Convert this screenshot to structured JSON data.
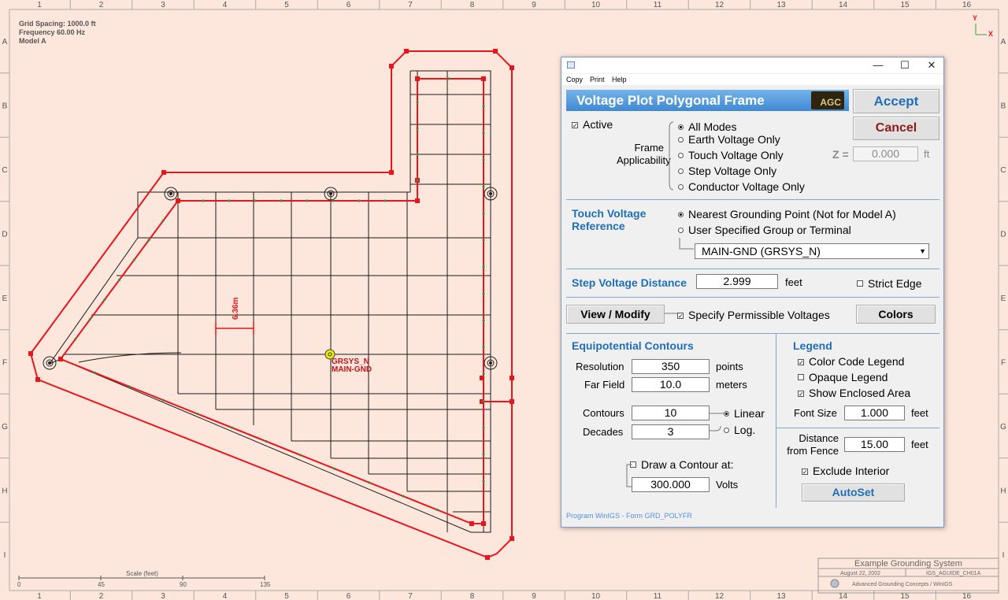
{
  "plot": {
    "info_lines": [
      "Grid Spacing: 1000.0 ft",
      "Frequency 60.00 Hz",
      "Model A"
    ],
    "col_labels": [
      "1",
      "2",
      "3",
      "4",
      "5",
      "6",
      "7",
      "8",
      "9",
      "10",
      "11",
      "12",
      "13",
      "14",
      "15",
      "16"
    ],
    "row_labels": [
      "A",
      "B",
      "C",
      "D",
      "E",
      "F",
      "G",
      "H",
      "I"
    ],
    "dimension_label": "6.36m",
    "ground_label_1": "GRSYS_N",
    "ground_label_2": "MAIN-GND",
    "axis_y": "Y",
    "axis_x": "X",
    "scale": {
      "title": "Scale (feet)",
      "ticks": [
        "0",
        "45",
        "90",
        "135"
      ]
    },
    "title_block": {
      "title": "Example Grounding System",
      "date": "August 22, 2002",
      "file": "IGS_AGUIDE_CH01A",
      "company": "Advanced Grounding Concepts / WinIGS"
    },
    "colors": {
      "frame": "#e8151b",
      "grid": "#111111",
      "background": "#fde6dc"
    }
  },
  "dialog": {
    "title_buttons": {
      "minimize": "—",
      "maximize": "☐",
      "close": "✕"
    },
    "menu": [
      "Copy",
      "Print",
      "Help"
    ],
    "banner": "Voltage Plot Polygonal Frame",
    "logo": "AGC",
    "accept": "Accept",
    "cancel": "Cancel",
    "active_label": "Active",
    "frame_applicability": "Frame\nApplicability",
    "frame_label_1": "Frame",
    "frame_label_2": "Applicability",
    "modes": [
      "All Modes",
      "Earth Voltage Only",
      "Touch Voltage Only",
      "Step Voltage Only",
      "Conductor Voltage Only"
    ],
    "z_label": "Z =",
    "z_value": "0.000",
    "z_unit": "ft",
    "touch_ref_1": "Touch Voltage",
    "touch_ref_2": "Reference",
    "touch_opt_1": "Nearest Grounding Point (Not for Model A)",
    "touch_opt_2": "User Specified Group or Terminal",
    "group_value": "MAIN-GND (GRSYS_N)",
    "step_label": "Step Voltage Distance",
    "step_value": "2.999",
    "step_unit": "feet",
    "strict_edge": "Strict Edge",
    "view_modify": "View / Modify",
    "specify_perm": "Specify Permissible Voltages",
    "colors_btn": "Colors",
    "equi_title": "Equipotential Contours",
    "resolution_label": "Resolution",
    "resolution_value": "350",
    "resolution_unit": "points",
    "farfield_label": "Far Field",
    "farfield_value": "10.0",
    "farfield_unit": "meters",
    "contours_label": "Contours",
    "contours_value": "10",
    "linear_label": "Linear",
    "decades_label": "Decades",
    "decades_value": "3",
    "log_label": "Log.",
    "draw_contour": "Draw a Contour at:",
    "contour_value": "300.000",
    "contour_unit": "Volts",
    "legend_title": "Legend",
    "color_code": "Color Code Legend",
    "opaque": "Opaque Legend",
    "show_enclosed": "Show Enclosed Area",
    "font_size_label": "Font Size",
    "font_size_value": "1.000",
    "font_size_unit": "feet",
    "distance_1": "Distance",
    "distance_2": "from Fence",
    "distance_value": "15.00",
    "distance_unit": "feet",
    "exclude_interior": "Exclude Interior",
    "autoset": "AutoSet",
    "status": "Program WinIGS - Form GRD_POLYFR"
  }
}
